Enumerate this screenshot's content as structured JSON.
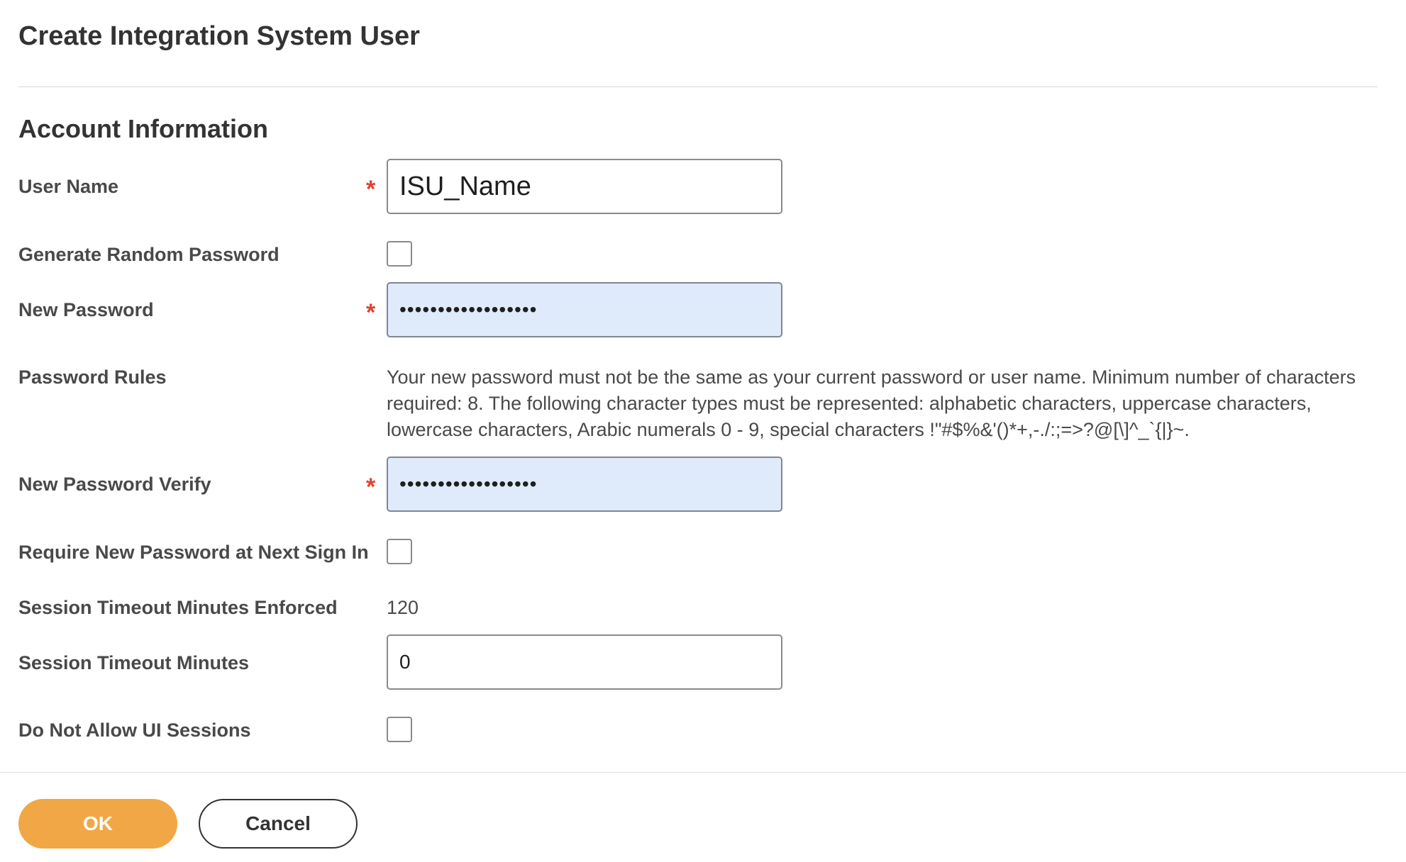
{
  "page": {
    "title": "Create Integration System User",
    "section_title": "Account Information"
  },
  "form": {
    "user_name": {
      "label": "User Name",
      "required_marker": "*",
      "value": "ISU_Name"
    },
    "generate_random_password": {
      "label": "Generate Random Password",
      "checked": false
    },
    "new_password": {
      "label": "New Password",
      "required_marker": "*",
      "value": "••••••••••••••••••"
    },
    "password_rules": {
      "label": "Password Rules",
      "text": "Your new password must not be the same as your current password or user name. Minimum number of characters required: 8. The following character types must be represented: alphabetic characters, uppercase characters, lowercase characters, Arabic numerals 0 - 9, special characters !\"#$%&'()*+,-./:;=>?@[\\]^_`{|}~."
    },
    "new_password_verify": {
      "label": "New Password Verify",
      "required_marker": "*",
      "value": "••••••••••••••••••"
    },
    "require_new_password": {
      "label": "Require New Password at Next Sign In",
      "checked": false
    },
    "session_timeout_enforced": {
      "label": "Session Timeout Minutes Enforced",
      "value": "120"
    },
    "session_timeout_minutes": {
      "label": "Session Timeout Minutes",
      "value": "0"
    },
    "do_not_allow_ui_sessions": {
      "label": "Do Not Allow UI Sessions",
      "checked": false
    }
  },
  "footer": {
    "ok_label": "OK",
    "cancel_label": "Cancel"
  },
  "colors": {
    "primary_button": "#f1a745",
    "required_marker": "#de4331",
    "password_field_bg": "#dfeafb"
  }
}
